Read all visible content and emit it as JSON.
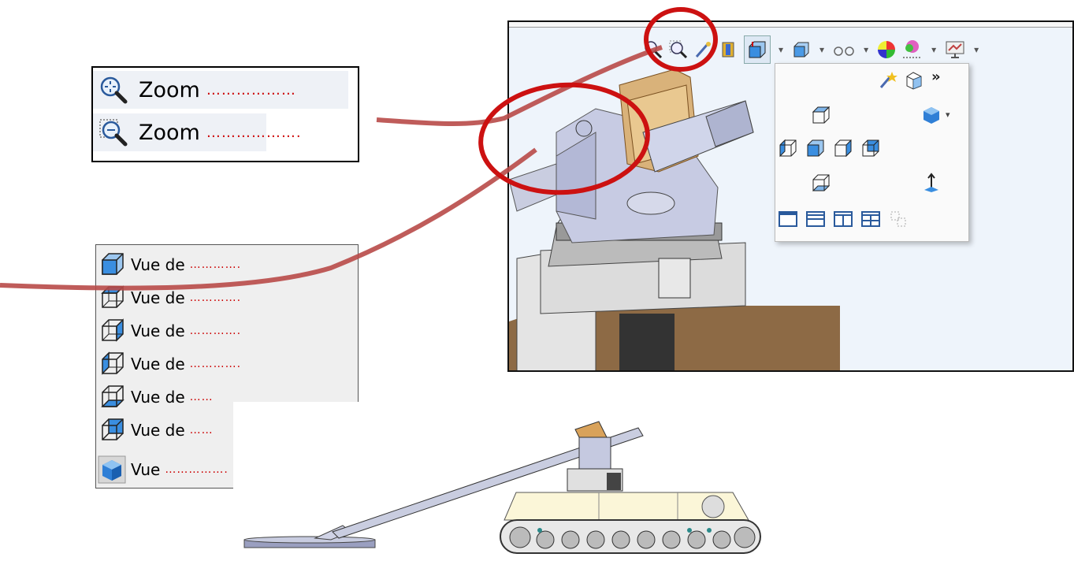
{
  "zoom_panel": {
    "items": [
      {
        "icon": "zoom-to-fit-icon",
        "label": "Zoom",
        "blank": "………………"
      },
      {
        "icon": "zoom-to-area-icon",
        "label": "Zoom",
        "blank": "……………….",
        "dotted_frame_color": "#999999"
      }
    ]
  },
  "view_panel": {
    "items": [
      {
        "icon": "front-view-icon",
        "label": "Vue de",
        "blank": "…………."
      },
      {
        "icon": "top-view-icon",
        "label": "Vue de",
        "blank": "…………."
      },
      {
        "icon": "right-view-icon",
        "label": "Vue de",
        "blank": "…………."
      },
      {
        "icon": "left-view-icon",
        "label": "Vue de",
        "blank": "…………."
      },
      {
        "icon": "bottom-view-icon",
        "label": "Vue de",
        "blank": "……"
      },
      {
        "icon": "back-view-icon",
        "label": "Vue de",
        "blank": "……"
      },
      {
        "icon": "isometric-view-icon",
        "label": "Vue",
        "blank": "……………."
      }
    ]
  },
  "viewport": {
    "toolbar": [
      "zoom-to-fit-icon",
      "zoom-to-area-icon",
      "previous-view-icon",
      "section-view-icon",
      "view-orientation-icon",
      "display-style-icon",
      "hide-show-items-icon",
      "edit-appearance-icon",
      "apply-scene-icon",
      "view-settings-icon"
    ],
    "orientation_menu": {
      "top_icons": [
        "new-view-icon",
        "view-selector-icon"
      ],
      "more_glyph": "»"
    }
  },
  "colors": {
    "annotation_circle": "#cc1111",
    "annotation_curve": "#b84a48",
    "blank_dots": "#cc0000",
    "cube_face": "#3a8ee0",
    "accent_gold": "#c98a3a"
  }
}
